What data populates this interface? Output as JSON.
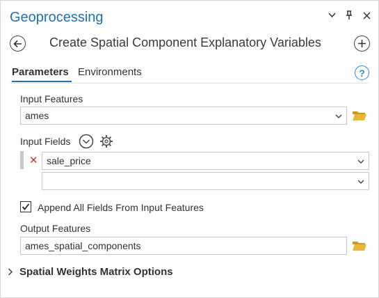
{
  "window": {
    "title": "Geoprocessing",
    "controls": [
      "chevron-down-icon",
      "pin-icon",
      "close-icon"
    ]
  },
  "tool": {
    "name": "Create Spatial Component Explanatory Variables"
  },
  "tabs": [
    {
      "label": "Parameters",
      "active": true
    },
    {
      "label": "Environments",
      "active": false
    }
  ],
  "params": {
    "input_features": {
      "label": "Input Features",
      "value": "ames"
    },
    "input_fields": {
      "label": "Input Fields",
      "rows": [
        {
          "value": "sale_price"
        },
        {
          "value": ""
        }
      ]
    },
    "append_all": {
      "label": "Append All Fields From Input Features",
      "checked": true
    },
    "output_features": {
      "label": "Output Features",
      "value": "ames_spatial_components"
    }
  },
  "sections": [
    {
      "label": "Spatial Weights Matrix Options",
      "expanded": false
    }
  ],
  "colors": {
    "accent": "#1f6fb5",
    "folder": "#e8b73a",
    "delete": "#c0392b"
  }
}
